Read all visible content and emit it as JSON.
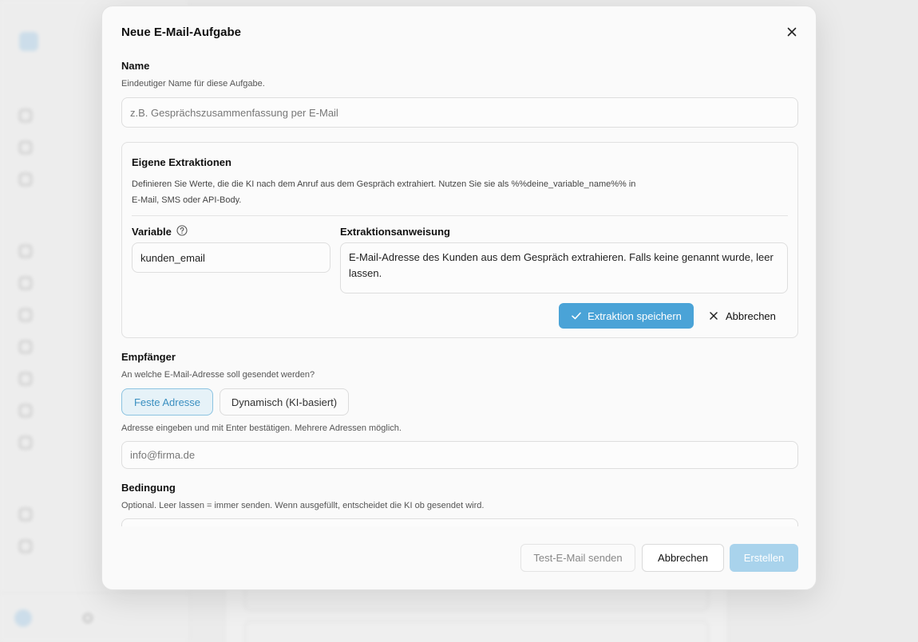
{
  "modal": {
    "title": "Neue E-Mail-Aufgabe",
    "name_section": {
      "label": "Name",
      "help": "Eindeutiger Name für diese Aufgabe.",
      "placeholder": "z.B. Gesprächszusammenfassung per E-Mail",
      "value": ""
    },
    "extractions": {
      "title": "Eigene Extraktionen",
      "description_line1": "Definieren Sie Werte, die die KI nach dem Anruf aus dem Gespräch extrahiert. Nutzen Sie sie als %%deine_variable_name%% in",
      "description_line2": "E-Mail, SMS oder API-Body.",
      "variable_label": "Variable",
      "variable_value": "kunden_email",
      "instruction_label": "Extraktionsanweisung",
      "instruction_value": "E-Mail-Adresse des Kunden aus dem Gespräch extrahieren. Falls keine genannt wurde, leer lassen.",
      "save_label": "Extraktion speichern",
      "cancel_label": "Abbrechen"
    },
    "recipient": {
      "label": "Empfänger",
      "help": "An welche E-Mail-Adresse soll gesendet werden?",
      "options": [
        "Feste Adresse",
        "Dynamisch (KI-basiert)"
      ],
      "selected": "Feste Adresse",
      "hint": "Adresse eingeben und mit Enter bestätigen. Mehrere Adressen möglich.",
      "placeholder": "info@firma.de"
    },
    "condition": {
      "label": "Bedingung",
      "help": "Optional. Leer lassen = immer senden. Wenn ausgefüllt, entscheidet die KI ob gesendet wird."
    },
    "footer": {
      "test_label": "Test-E-Mail senden",
      "cancel_label": "Abbrechen",
      "create_label": "Erstellen"
    }
  },
  "colors": {
    "accent": "#4aa3d7",
    "accent_light": "#a9d3ec",
    "selected_bg": "#e6f2f8"
  }
}
